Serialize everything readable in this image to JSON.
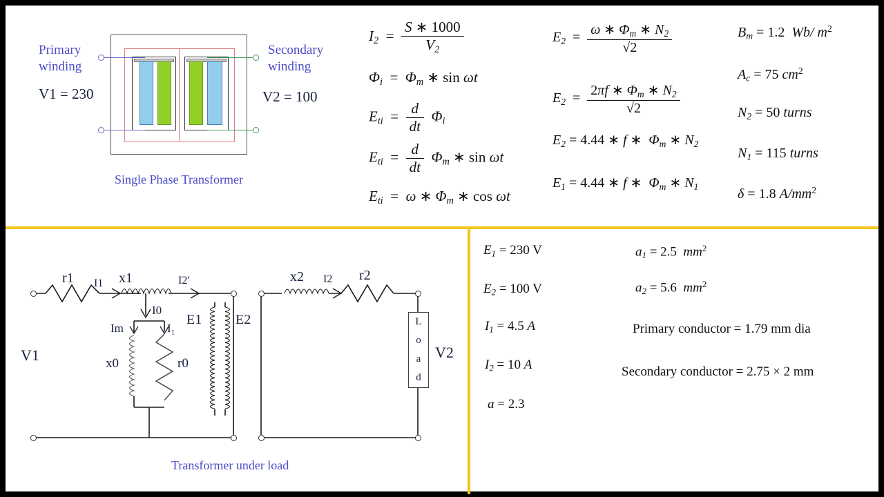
{
  "theme": {
    "divider_color": "#F5C518",
    "caption_color": "#4B4BC8",
    "coil_blue": "#92CDEC",
    "coil_green": "#92D028",
    "core_red": "#E08080",
    "primary_lead": "#6A6ACB",
    "secondary_lead": "#3E9E55"
  },
  "transformer_figure": {
    "primary_label_line1": "Primary",
    "primary_label_line2": "winding",
    "secondary_label_line1": "Secondary",
    "secondary_label_line2": "winding",
    "v1": "V1 = 230",
    "v2": "V2 = 100",
    "caption": "Single Phase Transformer"
  },
  "equations_col1": [
    {
      "lhs": "I",
      "lhs_sub": "2",
      "type": "fraction",
      "num": "S ∗ 1000",
      "den_base": "V",
      "den_sub": "2"
    },
    {
      "type": "plain",
      "text": "Φᵢ  =  Φₘ ∗ sin ωt"
    },
    {
      "type": "ddt",
      "lhs": "E",
      "lhs_sub": "ti",
      "tail": "Φᵢ"
    },
    {
      "type": "ddt",
      "lhs": "E",
      "lhs_sub": "ti",
      "tail": "Φₘ ∗ sin ωt"
    },
    {
      "type": "plain",
      "text": "Eₜᵢ =  ω ∗ Φₘ ∗ cos ωt"
    }
  ],
  "equations_col2": [
    {
      "type": "fraction",
      "lhs": "E",
      "lhs_sub": "2",
      "num": "ω ∗ Φₘ ∗ N₂",
      "den": "√2"
    },
    {
      "type": "fraction",
      "lhs": "E",
      "lhs_sub": "2",
      "num": "2πf ∗ Φₘ ∗ N₂",
      "den": "√2"
    },
    {
      "type": "plain",
      "text": "E₂ = 4.44 ∗ f ∗  Φₘ ∗ N₂"
    },
    {
      "type": "plain",
      "text": "E₁ = 4.44 ∗ f ∗  Φₘ ∗ N₁"
    }
  ],
  "parameters_col3": [
    {
      "text": "Bₘ = 1.2  Wb/ m²"
    },
    {
      "text": "A_c = 75 cm²"
    },
    {
      "text": "N₂ = 50 turns"
    },
    {
      "text": "N₁ = 115 turns"
    },
    {
      "text": "δ = 1.8 A/mm²"
    }
  ],
  "circuit": {
    "labels": {
      "r1": "r1",
      "x1": "x1",
      "i1": "I1",
      "i2p": "I2'",
      "i0": "I0",
      "im": "Im",
      "i_l": "I₁",
      "x0": "x0",
      "r0": "r0",
      "e1": "E1",
      "e2": "E2",
      "x2": "x2",
      "i2": "I2",
      "r2": "r2",
      "v1": "V1",
      "v2": "V2"
    },
    "load_letters": [
      "L",
      "o",
      "a",
      "d"
    ],
    "caption": "Transformer under load"
  },
  "results_left": [
    {
      "text": "E₁ = 230 V"
    },
    {
      "text": "E₂ = 100 V"
    },
    {
      "text": "I₁ = 4.5 A"
    },
    {
      "text": "I₂ = 10 A"
    },
    {
      "text": "a = 2.3"
    }
  ],
  "results_right": [
    {
      "text": "a₁ = 2.5  mm²"
    },
    {
      "text": "a₂ = 5.6  mm²"
    },
    {
      "text": "Primary conductor  =  1.79 mm dia"
    },
    {
      "text": "Secondary conductor  =  2.75 × 2  mm"
    }
  ]
}
